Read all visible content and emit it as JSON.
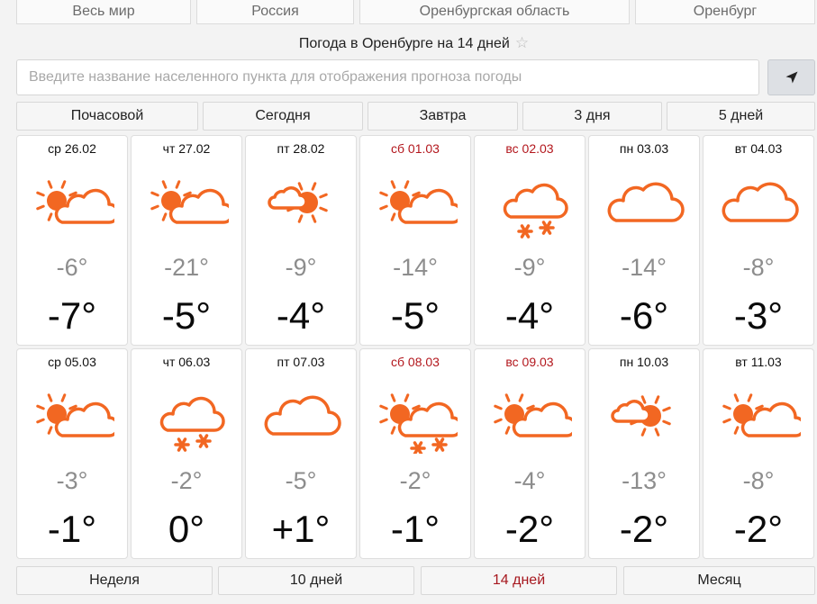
{
  "breadcrumbs": [
    "Весь мир",
    "Россия",
    "Оренбургская область",
    "Оренбург"
  ],
  "page_title": "Погода в Оренбурге на 14 дней",
  "search": {
    "placeholder": "Введите название населенного пункта для отображения прогноза погоды",
    "value": ""
  },
  "top_tabs": [
    "Почасовой",
    "Сегодня",
    "Завтра",
    "3 дня",
    "5 дней"
  ],
  "bottom_tabs": [
    "Неделя",
    "10 дней",
    "14 дней",
    "Месяц"
  ],
  "active_tab": "14 дней",
  "colors": {
    "accent": "#a7181f",
    "icon_orange": "#f26722",
    "weekend": "#b3171d"
  },
  "days": [
    {
      "date": "ср 26.02",
      "weekend": false,
      "icon": "sun-cloud-icon",
      "tmin": "-6°",
      "tmax": "-7°"
    },
    {
      "date": "чт 27.02",
      "weekend": false,
      "icon": "sun-cloud-icon",
      "tmin": "-21°",
      "tmax": "-5°"
    },
    {
      "date": "пт 28.02",
      "weekend": false,
      "icon": "sun-small-cloud-icon",
      "tmin": "-9°",
      "tmax": "-4°"
    },
    {
      "date": "сб 01.03",
      "weekend": true,
      "icon": "sun-cloud-icon",
      "tmin": "-14°",
      "tmax": "-5°"
    },
    {
      "date": "вс 02.03",
      "weekend": true,
      "icon": "cloud-snow-icon",
      "tmin": "-9°",
      "tmax": "-4°"
    },
    {
      "date": "пн 03.03",
      "weekend": false,
      "icon": "cloudy-icon",
      "tmin": "-14°",
      "tmax": "-6°"
    },
    {
      "date": "вт 04.03",
      "weekend": false,
      "icon": "cloudy-icon",
      "tmin": "-8°",
      "tmax": "-3°"
    },
    {
      "date": "ср 05.03",
      "weekend": false,
      "icon": "sun-cloud-icon",
      "tmin": "-3°",
      "tmax": "-1°"
    },
    {
      "date": "чт 06.03",
      "weekend": false,
      "icon": "cloud-snow-icon",
      "tmin": "-2°",
      "tmax": "0°"
    },
    {
      "date": "пт 07.03",
      "weekend": false,
      "icon": "cloudy-icon",
      "tmin": "-5°",
      "tmax": "+1°"
    },
    {
      "date": "сб 08.03",
      "weekend": true,
      "icon": "sun-cloud-snow-icon",
      "tmin": "-2°",
      "tmax": "-1°"
    },
    {
      "date": "вс 09.03",
      "weekend": true,
      "icon": "sun-cloud-icon",
      "tmin": "-4°",
      "tmax": "-2°"
    },
    {
      "date": "пн 10.03",
      "weekend": false,
      "icon": "sun-small-cloud-icon",
      "tmin": "-13°",
      "tmax": "-2°"
    },
    {
      "date": "вт 11.03",
      "weekend": false,
      "icon": "sun-cloud-icon",
      "tmin": "-8°",
      "tmax": "-2°"
    }
  ]
}
